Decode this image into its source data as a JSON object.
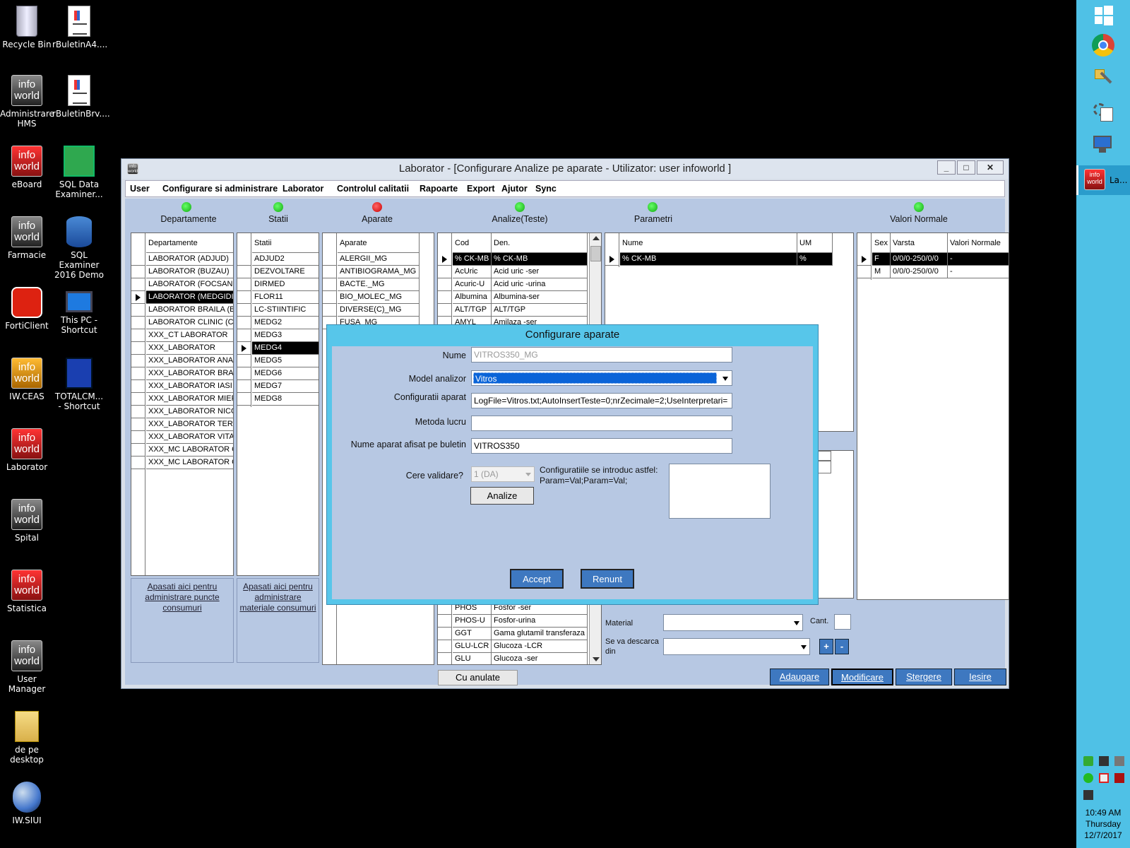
{
  "desktop": {
    "icons": [
      {
        "label": "Recycle Bin",
        "kind": "recycle"
      },
      {
        "label": "rBuletinA4....",
        "kind": "doc"
      },
      {
        "label": "Administrare HMS",
        "kind": "iw"
      },
      {
        "label": "rBuletinBrv....",
        "kind": "doc"
      },
      {
        "label": "eBoard",
        "kind": "iw-red"
      },
      {
        "label": "SQL Data Examiner...",
        "kind": "sql-green"
      },
      {
        "label": "Farmacie",
        "kind": "iw"
      },
      {
        "label": "SQL Examiner 2016 Demo",
        "kind": "sql-blue"
      },
      {
        "label": "FortiClient",
        "kind": "forti"
      },
      {
        "label": "This PC - Shortcut",
        "kind": "pc"
      },
      {
        "label": "IW.CEAS",
        "kind": "iw-orange"
      },
      {
        "label": "TOTALCM... - Shortcut",
        "kind": "floppy"
      },
      {
        "label": "Laborator",
        "kind": "iw-red"
      },
      {
        "label": "Spital",
        "kind": "iw"
      },
      {
        "label": "Statistica",
        "kind": "iw-red"
      },
      {
        "label": "User Manager",
        "kind": "iw"
      },
      {
        "label": "de pe desktop",
        "kind": "folder"
      },
      {
        "label": "IW.SIUI",
        "kind": "globe"
      }
    ]
  },
  "window": {
    "title": "Laborator - [Configurare Analize pe aparate - Utilizator: user infoworld ]",
    "min": "_",
    "max": "□",
    "close": "✕"
  },
  "menu": [
    "User",
    "Configurare si administrare",
    "Laborator",
    "Controlul calitatii",
    "Rapoarte",
    "Export",
    "Ajutor",
    "Sync"
  ],
  "headers": {
    "departamente": "Departamente",
    "statii": "Statii",
    "aparate": "Aparate",
    "analize": "Analize(Teste)",
    "parametri": "Parametri",
    "valori": "Valori Normale"
  },
  "colors": {
    "green": "#22cc22",
    "red": "#ee1111",
    "accent": "#3e78c0"
  },
  "departamente": {
    "col": "Departamente",
    "rows": [
      "LABORATOR (ADJUD)",
      "LABORATOR (BUZAU)",
      "LABORATOR (FOCSANI)",
      "LABORATOR (MEDGIDIA",
      "LABORATOR BRAILA (BI",
      "LABORATOR CLINIC (CHI",
      "XXX_CT LABORATOR",
      "XXX_LABORATOR",
      "XXX_LABORATOR ANAL",
      "XXX_LABORATOR BRAS",
      "XXX_LABORATOR IASI",
      "XXX_LABORATOR MIERC",
      "XXX_LABORATOR NICOL",
      "XXX_LABORATOR TEREI",
      "XXX_LABORATOR VITAN",
      "XXX_MC LABORATOR CI",
      "XXX_MC LABORATOR CI"
    ],
    "selected": 3
  },
  "statii": {
    "col": "Statii",
    "rows": [
      "ADJUD2",
      "DEZVOLTARE",
      "DIRMED",
      "FLOR11",
      "LC-STIINTIFIC",
      "MEDG2",
      "MEDG3",
      "MEDG4",
      "MEDG5",
      "MEDG6",
      "MEDG7",
      "MEDG8"
    ],
    "selected": 7
  },
  "aparate": {
    "col": "Aparate",
    "rows": [
      "ALERGII_MG",
      "ANTIBIOGRAMA_MG",
      "BACTE._MG",
      "BIO_MOLEC_MG",
      "DIVERSE(C)_MG",
      "FUSA_MG"
    ]
  },
  "analize": {
    "cols": [
      "Cod",
      "Den."
    ],
    "rows_top": [
      [
        "% CK-MB",
        "% CK-MB"
      ],
      [
        "AcUric",
        "Acid uric -ser"
      ],
      [
        "Acuric-U",
        "Acid uric -urina"
      ],
      [
        "Albumina",
        "Albumina-ser"
      ],
      [
        "ALT/TGP",
        "ALT/TGP"
      ],
      [
        "AMYL",
        "Amilaza -ser"
      ]
    ],
    "rows_bottom": [
      [
        "PHOS",
        "Fosfor -ser"
      ],
      [
        "PHOS-U",
        "Fosfor-urina"
      ],
      [
        "GGT",
        "Gama glutamil transferaza (("
      ],
      [
        "GLU-LCR",
        "Glucoza -LCR"
      ],
      [
        "GLU",
        "Glucoza -ser"
      ]
    ]
  },
  "parametri": {
    "cols": [
      "Nume",
      "UM"
    ],
    "rows": [
      [
        "% CK-MB",
        "%"
      ]
    ]
  },
  "valori": {
    "cols": [
      "Sex",
      "Varsta",
      "Valori Normale"
    ],
    "rows": [
      [
        "F",
        "0/0/0-250/0/0",
        "-"
      ],
      [
        "M",
        "0/0/0-250/0/0",
        "-"
      ]
    ]
  },
  "links": {
    "puncte": "Apasati aici pentru administrare puncte consumuri",
    "materiale": "Apasati aici pentru administrare materiale consumuri"
  },
  "cu_anulate": "Cu anulate",
  "material": {
    "label": "Material",
    "cant_label": "Cant.",
    "descarca_label": "Se va descarca din",
    "plus": "+",
    "minus": "-"
  },
  "buttons": {
    "adaugare": "Adaugare",
    "modificare": "Modificare",
    "stergere": "Stergere",
    "iesire": "Iesire"
  },
  "dialog": {
    "title": "Configurare aparate",
    "nume_label": "Nume",
    "nume_value": "VITROS350_MG",
    "model_label": "Model analizor",
    "model_value": "Vitros",
    "config_label": "Configuratii aparat",
    "config_value": "LogFile=Vitros.txt;AutoInsertTeste=0;nrZecimale=2;UseInterpretari=",
    "metoda_label": "Metoda lucru",
    "metoda_value": "",
    "afisat_label": "Nume aparat afisat pe buletin",
    "afisat_value": "VITROS350",
    "validare_label": "Cere validare?",
    "validare_value": "1 (DA)",
    "hint": "Configuratiile se introduc astfel: Param=Val;Param=Val;",
    "analize_btn": "Analize",
    "accept_btn": "Accept",
    "renunt_btn": "Renunt"
  },
  "taskbar": {
    "app_label": "La...",
    "time": "10:49 AM",
    "day": "Thursday",
    "date": "12/7/2017"
  }
}
